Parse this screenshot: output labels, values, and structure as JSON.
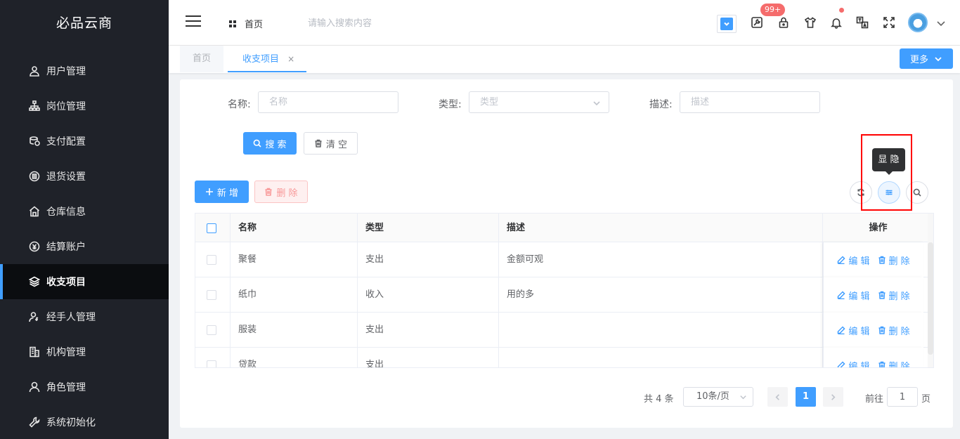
{
  "app": {
    "title": "必品云商"
  },
  "sidebar": {
    "items": [
      {
        "label": "用户管理",
        "icon": "user-icon"
      },
      {
        "label": "岗位管理",
        "icon": "org-chart-icon"
      },
      {
        "label": "支付配置",
        "icon": "coins-icon"
      },
      {
        "label": "退货设置",
        "icon": "return-icon"
      },
      {
        "label": "仓库信息",
        "icon": "warehouse-icon"
      },
      {
        "label": "结算账户",
        "icon": "account-icon"
      },
      {
        "label": "收支项目",
        "icon": "layers-icon",
        "active": true
      },
      {
        "label": "经手人管理",
        "icon": "handler-icon"
      },
      {
        "label": "机构管理",
        "icon": "building-icon"
      },
      {
        "label": "角色管理",
        "icon": "role-icon"
      },
      {
        "label": "系统初始化",
        "icon": "wrench-icon"
      }
    ]
  },
  "header": {
    "home_label": "首页",
    "search_placeholder": "请输入搜索内容",
    "notification_badge": "99+"
  },
  "tabs": {
    "items": [
      {
        "label": "首页"
      },
      {
        "label": "收支项目",
        "close": "×",
        "active": true
      }
    ],
    "more_label": "更多"
  },
  "form": {
    "name_label": "名称:",
    "name_placeholder": "名称",
    "type_label": "类型:",
    "type_placeholder": "类型",
    "desc_label": "描述:",
    "desc_placeholder": "描述",
    "search_label": "搜 索",
    "clear_label": "清 空"
  },
  "toolbar": {
    "add_label": "新 增",
    "delete_label": "删 除",
    "tooltip": "显 隐"
  },
  "table": {
    "columns": [
      "名称",
      "类型",
      "描述",
      "操作"
    ],
    "rows": [
      {
        "name": "聚餐",
        "type": "支出",
        "desc": "金额可观"
      },
      {
        "name": "纸巾",
        "type": "收入",
        "desc": "用的多"
      },
      {
        "name": "服装",
        "type": "支出",
        "desc": ""
      },
      {
        "name": "贷款",
        "type": "支出",
        "desc": ""
      }
    ],
    "edit_label": "编 辑",
    "row_delete_label": "删 除"
  },
  "pagination": {
    "total": "共 4 条",
    "page_size": "10条/页",
    "current_page": "1",
    "goto_label": "前往",
    "goto_value": "1",
    "unit": "页"
  },
  "colors": {
    "primary": "#409eff",
    "sidebar_bg": "#1f2229",
    "danger": "#f56c6c",
    "highlight_box": "#ff0000"
  }
}
